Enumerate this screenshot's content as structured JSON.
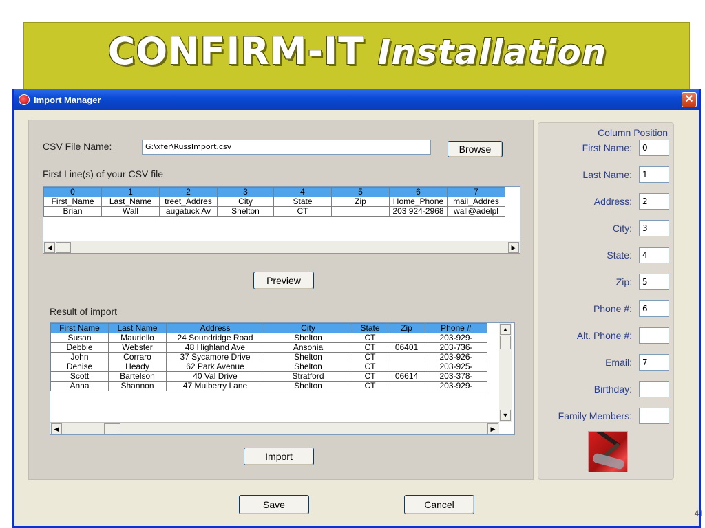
{
  "slide": {
    "title_main": "CONFIRM-IT ",
    "title_italic": "Installation",
    "page_number": "41"
  },
  "window": {
    "title": "Import Manager",
    "close_glyph": "✕"
  },
  "csv": {
    "file_label": "CSV File Name:",
    "file_value": "G:\\xfer\\RussImport.csv",
    "browse_label": "Browse",
    "first_lines_label": "First Line(s) of your CSV file",
    "columns": [
      "0",
      "1",
      "2",
      "3",
      "4",
      "5",
      "6",
      "7"
    ],
    "rows": [
      [
        "First_Name",
        "Last_Name",
        "treet_Addres",
        "City",
        "State",
        "Zip",
        "Home_Phone",
        "mail_Addres"
      ],
      [
        "Brian",
        "Wall",
        "augatuck Av",
        "Shelton",
        "CT",
        "",
        "203 924-2968",
        "wall@adelpl"
      ]
    ]
  },
  "preview_label": "Preview",
  "result": {
    "label": "Result of import",
    "columns": [
      "First Name",
      "Last Name",
      "Address",
      "City",
      "State",
      "Zip",
      "Phone #"
    ],
    "rows": [
      [
        "Susan",
        "Mauriello",
        "24 Soundridge Road",
        "Shelton",
        "CT",
        "",
        "203-929-"
      ],
      [
        "Debbie",
        "Webster",
        "48 Highland Ave",
        "Ansonia",
        "CT",
        "06401",
        "203-736-"
      ],
      [
        "John",
        "Corraro",
        "37 Sycamore Drive",
        "Shelton",
        "CT",
        "",
        "203-926-"
      ],
      [
        "Denise",
        "Heady",
        "62 Park Avenue",
        "Shelton",
        "CT",
        "",
        "203-925-"
      ],
      [
        "Scott",
        "Bartelson",
        "40 Val Drive",
        "Stratford",
        "CT",
        "06614",
        "203-378-"
      ],
      [
        "Anna",
        "Shannon",
        "47 Mulberry Lane",
        "Shelton",
        "CT",
        "",
        "203-929-"
      ]
    ]
  },
  "import_label": "Import",
  "save_label": "Save",
  "cancel_label": "Cancel",
  "positions": {
    "header": "Column Position",
    "fields": [
      {
        "label": "First Name:",
        "value": "0"
      },
      {
        "label": "Last Name:",
        "value": "1"
      },
      {
        "label": "Address:",
        "value": "2"
      },
      {
        "label": "City:",
        "value": "3"
      },
      {
        "label": "State:",
        "value": "4"
      },
      {
        "label": "Zip:",
        "value": "5"
      },
      {
        "label": "Phone #:",
        "value": "6"
      },
      {
        "label": "Alt. Phone #:",
        "value": ""
      },
      {
        "label": "Email:",
        "value": "7"
      },
      {
        "label": "Birthday:",
        "value": ""
      },
      {
        "label": "Family Members:",
        "value": ""
      }
    ]
  },
  "colors": {
    "banner": "#c9c82a",
    "titlebar": "#0a4bd6",
    "grid_header": "#4fa3ea",
    "label_blue": "#2a3f8f"
  },
  "icons": {
    "app": "import-manager-icon",
    "close": "close-icon",
    "scroll_left": "◀",
    "scroll_right": "▶",
    "scroll_up": "▲",
    "scroll_down": "▼"
  }
}
